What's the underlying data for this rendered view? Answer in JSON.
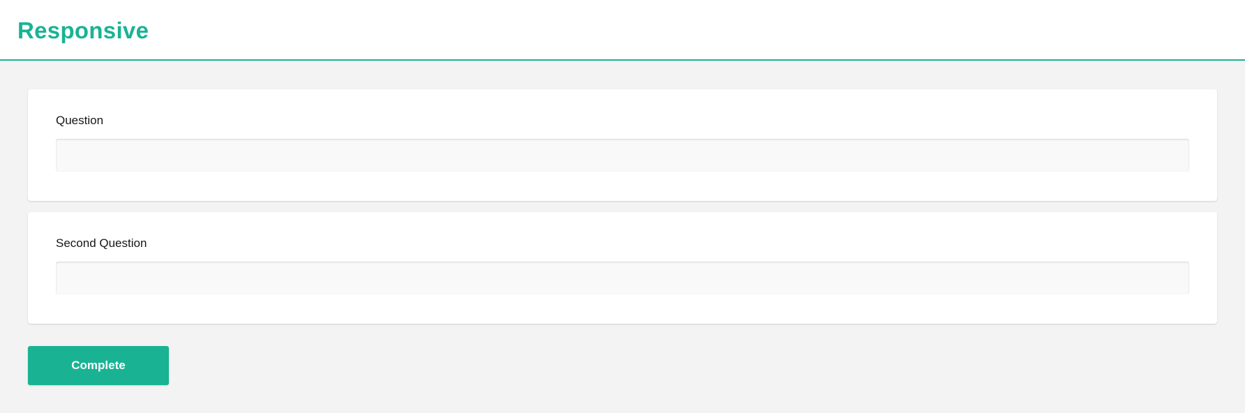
{
  "header": {
    "title": "Responsive"
  },
  "questions": [
    {
      "title": "Question",
      "value": "",
      "placeholder": ""
    },
    {
      "title": "Second Question",
      "value": "",
      "placeholder": ""
    }
  ],
  "actions": {
    "complete_label": "Complete"
  },
  "colors": {
    "accent": "#19b394",
    "background": "#f3f3f3",
    "card": "#ffffff",
    "input_background": "#f9f9f9",
    "text": "#161616"
  }
}
